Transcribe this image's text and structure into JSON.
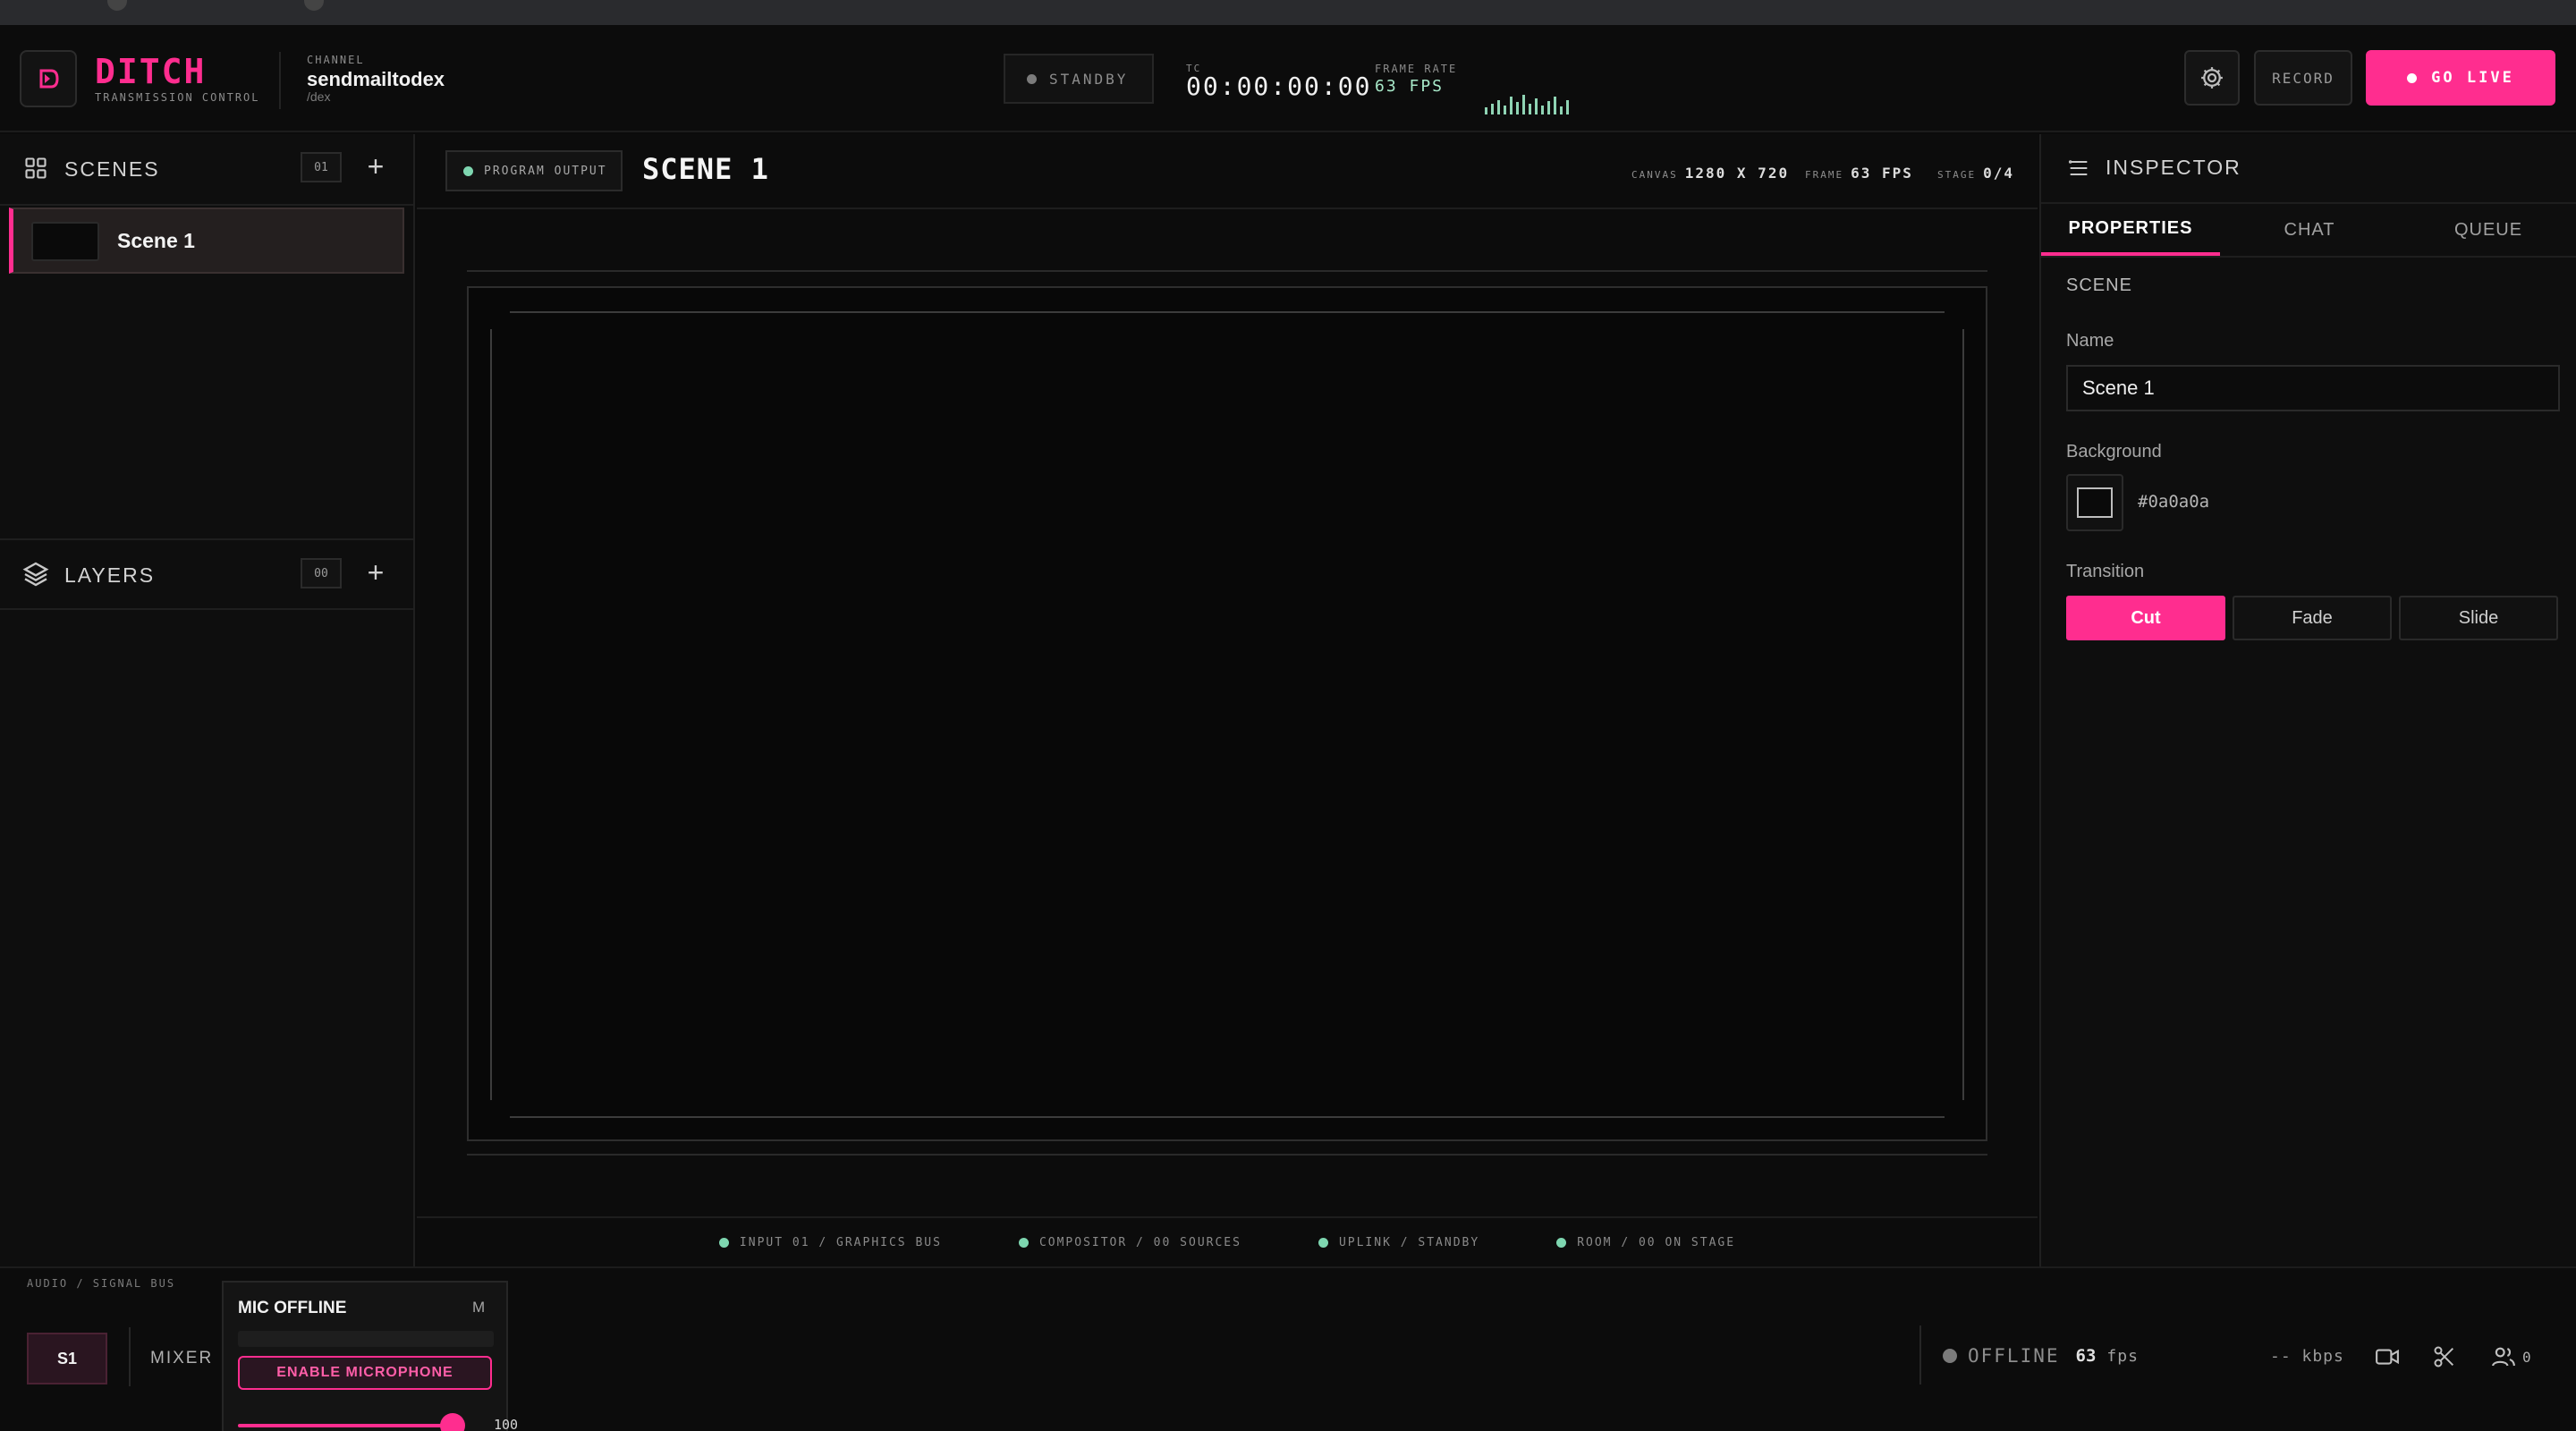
{
  "header": {
    "brand": "DITCH",
    "brand_sub": "TRANSMISSION CONTROL",
    "channel_label": "CHANNEL",
    "channel_name": "sendmailtodex",
    "channel_handle": "/dex",
    "status": "STANDBY",
    "tc_label": "TC",
    "timecode": "00:00:00:00",
    "frame_rate_label": "FRAME RATE",
    "frame_rate": "63 FPS",
    "record_label": "RECORD",
    "golive_label": "GO LIVE"
  },
  "scenes": {
    "title": "SCENES",
    "count": "01",
    "items": [
      {
        "label": "Scene 1"
      }
    ]
  },
  "layers": {
    "title": "LAYERS",
    "count": "00"
  },
  "program": {
    "badge": "PROGRAM OUTPUT",
    "scene_title": "SCENE 1",
    "canvas_label": "CANVAS",
    "canvas_value": "1280 X 720",
    "frame_label": "FRAME",
    "frame_value": "63 FPS",
    "stage_label": "STAGE",
    "stage_value": "0/4"
  },
  "footer_status": [
    "INPUT 01 / GRAPHICS BUS",
    "COMPOSITOR / 00 SOURCES",
    "UPLINK / STANDBY",
    "ROOM / 00 ON STAGE"
  ],
  "inspector": {
    "title": "INSPECTOR",
    "tabs": [
      "PROPERTIES",
      "CHAT",
      "QUEUE"
    ],
    "active_tab": "PROPERTIES",
    "section": "SCENE",
    "name_label": "Name",
    "name_value": "Scene 1",
    "background_label": "Background",
    "background_value": "#0a0a0a",
    "transition_label": "Transition",
    "transitions": [
      "Cut",
      "Fade",
      "Slide"
    ],
    "active_transition": "Cut"
  },
  "bottom": {
    "bus_label": "AUDIO / SIGNAL BUS",
    "s1": "S1",
    "mixer": "MIXER",
    "mic_title": "MIC OFFLINE",
    "mic_mute": "M",
    "enable_mic": "ENABLE MICROPHONE",
    "volume": "100",
    "volume_level": 1.0,
    "offline": "OFFLINE",
    "fps_value": "63",
    "fps_unit": "fps",
    "kbps": "-- kbps",
    "viewers": "0"
  },
  "colors": {
    "accent": "#ff2d8f",
    "status_green": "#7ed6b0",
    "background": "#0b0b0b"
  },
  "icons": [
    "logo-icon",
    "gear-icon",
    "grid-icon",
    "layers-icon",
    "menu-icon",
    "plus-icon",
    "camera-icon",
    "scissors-icon",
    "users-icon"
  ]
}
